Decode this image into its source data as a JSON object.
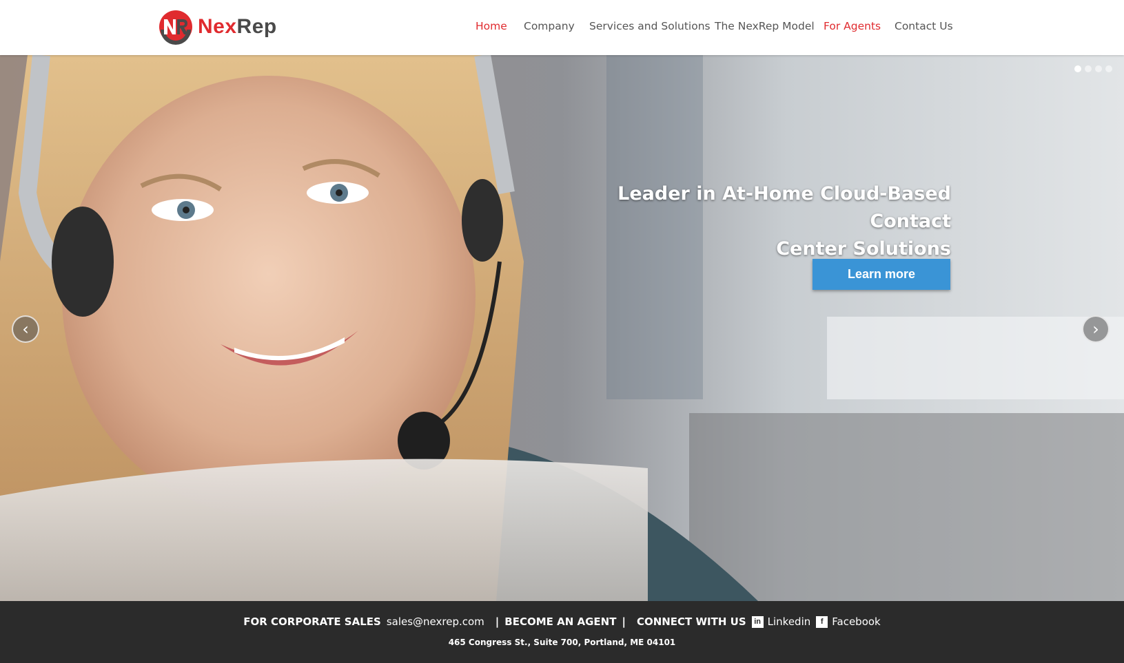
{
  "brand": {
    "logo_word_1": "Nex",
    "logo_word_2": "Rep",
    "logo_mark": "NR",
    "accent_color": "#e02b2f"
  },
  "nav": {
    "items": [
      {
        "label": "Home",
        "active": true
      },
      {
        "label": "Company",
        "active": false
      },
      {
        "label": "Services and Solutions",
        "active": false
      },
      {
        "label": "The NexRep Model",
        "active": false
      },
      {
        "label": "For Agents",
        "active": true
      },
      {
        "label": "Contact Us",
        "active": false
      }
    ]
  },
  "hero": {
    "headline_line1": "Leader in At-Home Cloud-Based Contact",
    "headline_line2": "Center Solutions",
    "button_label": "Learn more",
    "button_color": "#3a94d6",
    "slide_count": 4,
    "active_slide": 1,
    "prev_icon": "‹",
    "next_icon": "›"
  },
  "footer": {
    "corporate_label": "FOR CORPORATE SALES",
    "corporate_email": "sales@nexrep.com",
    "separator": "|",
    "become_agent_label": "BECOME AN AGENT",
    "connect_label": "CONNECT WITH US",
    "linkedin_icon": "in",
    "linkedin_label": "Linkedin",
    "facebook_icon": "f",
    "facebook_label": "Facebook",
    "address": "465 Congress St., Suite 700, Portland, ME 04101"
  }
}
